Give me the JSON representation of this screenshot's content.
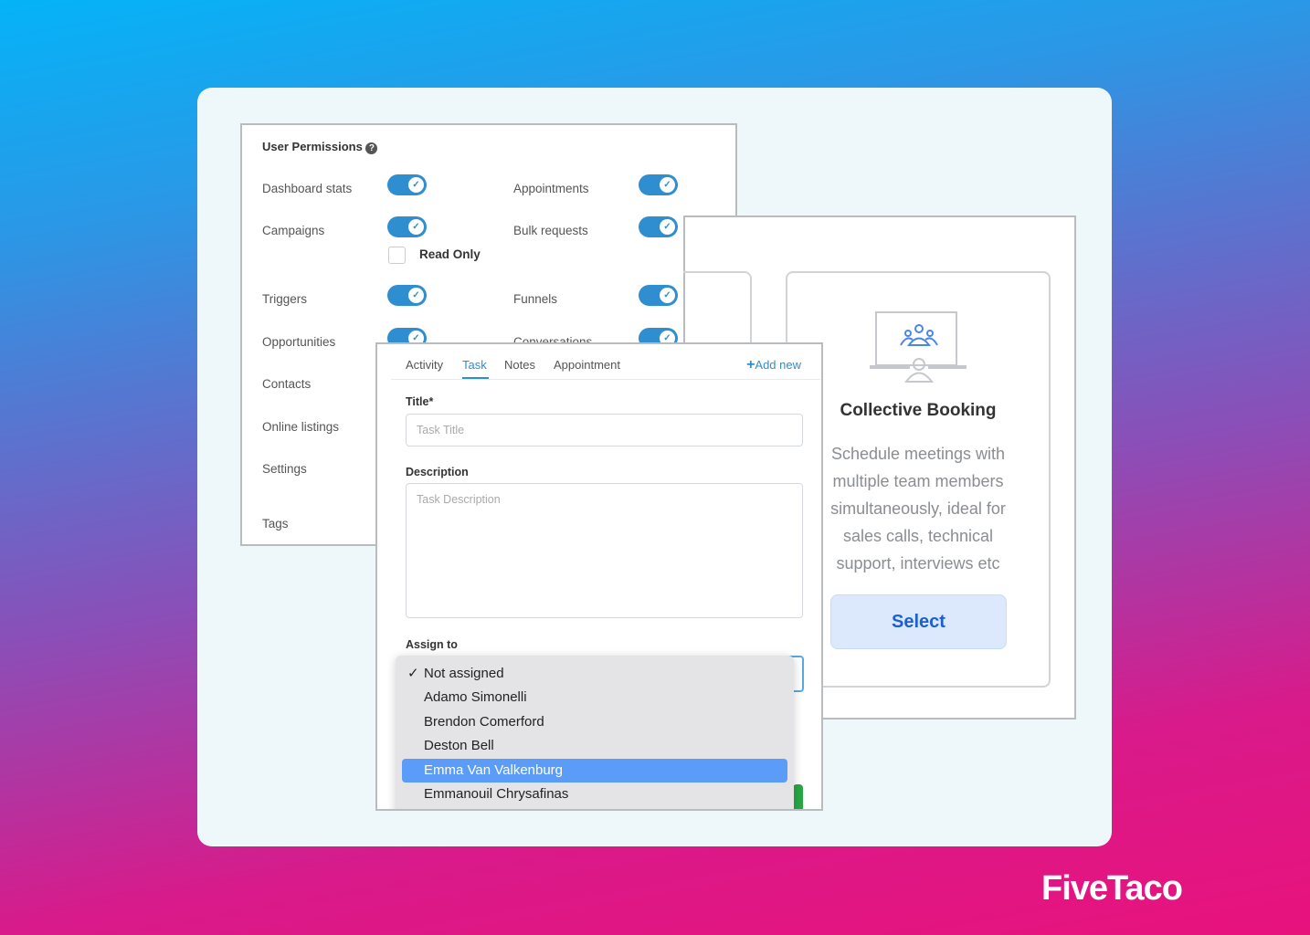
{
  "permissions": {
    "title": "User Permissions",
    "help_icon": "question-circle-icon",
    "left": [
      {
        "label": "Dashboard stats",
        "on": true
      },
      {
        "label": "Campaigns",
        "on": true
      },
      {
        "label": "Triggers",
        "on": true
      },
      {
        "label": "Opportunities",
        "on": true
      },
      {
        "label": "Contacts"
      },
      {
        "label": "Online listings"
      },
      {
        "label": "Settings"
      },
      {
        "label": "Tags"
      }
    ],
    "right": [
      {
        "label": "Appointments",
        "on": true
      },
      {
        "label": "Bulk requests",
        "on": true
      },
      {
        "label": "Funnels",
        "on": true
      },
      {
        "label": "Conversations",
        "on": true
      }
    ],
    "read_only": {
      "label": "Read Only",
      "checked": false
    }
  },
  "task": {
    "tabs": [
      "Activity",
      "Task",
      "Notes",
      "Appointment"
    ],
    "active_tab": "Task",
    "add_new": "Add new",
    "title_label": "Title*",
    "title_placeholder": "Task Title",
    "desc_label": "Description",
    "desc_placeholder": "Task Description",
    "assign_label": "Assign to",
    "options": [
      "Not assigned",
      "Adamo Simonelli",
      "Brendon Comerford",
      "Deston Bell",
      "Emma Van Valkenburg",
      "Emmanouil Chrysafinas"
    ],
    "selected": "Not assigned",
    "highlighted": "Emma Van Valkenburg"
  },
  "booking": {
    "title": "Collective Booking",
    "description": "Schedule meetings with multiple team members simultaneously, ideal for sales calls, technical support, interviews etc",
    "select": "Select"
  },
  "brand": "FiveTaco",
  "colors": {
    "accent": "#2f8ecf",
    "highlight": "#5a9cf8",
    "select_bg": "#dce9fd",
    "select_text": "#1a5fd6"
  }
}
